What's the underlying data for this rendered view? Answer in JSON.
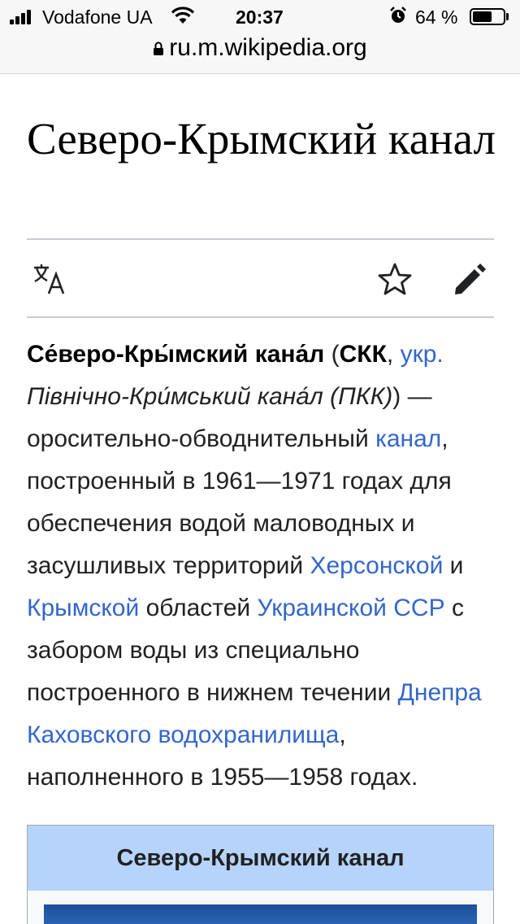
{
  "status_bar": {
    "carrier": "Vodafone UA",
    "time": "20:37",
    "battery_percent": "64 %",
    "battery_level": 0.64,
    "icons": [
      "signal-icon",
      "wifi-icon",
      "alarm-icon",
      "battery-icon"
    ]
  },
  "url_bar": {
    "url": "ru.m.wikipedia.org",
    "icon": "lock-icon"
  },
  "article": {
    "title": "Северо-Крымский канал",
    "actions": {
      "language_icon": "translate-icon",
      "watch_icon": "star-icon",
      "edit_icon": "pencil-icon"
    },
    "lead": {
      "bold_name": "Се́веро-Кры́мский кана́л",
      "t1": " (",
      "bold_abbr": "СКК",
      "t2": ", ",
      "link_ukr": "укр.",
      "italic_ukr": "Північно-Кри́мський кана́л (ПКК)",
      "t3": ") — оросительно-обводнительный ",
      "link_canal": "канал",
      "t4": ", построенный в 1961—1971 годах для обеспечения водой маловодных и засушливых территорий ",
      "link_kherson": "Херсонской",
      "t5": " и ",
      "link_crimea": "Крымской",
      "t6": " областей ",
      "link_ussr": "Украинской ССР",
      "t7": " с забором воды из специально построенного в нижнем течении ",
      "link_dnepr": "Днепра Каховского водохранилища",
      "t8": ", наполненного в 1955—1958 годах."
    },
    "infobox": {
      "title": "Северо-Крымский канал"
    }
  },
  "colors": {
    "link": "#3366cc",
    "infobox_header": "#b6d4fb",
    "divider": "#c8ccd1"
  }
}
